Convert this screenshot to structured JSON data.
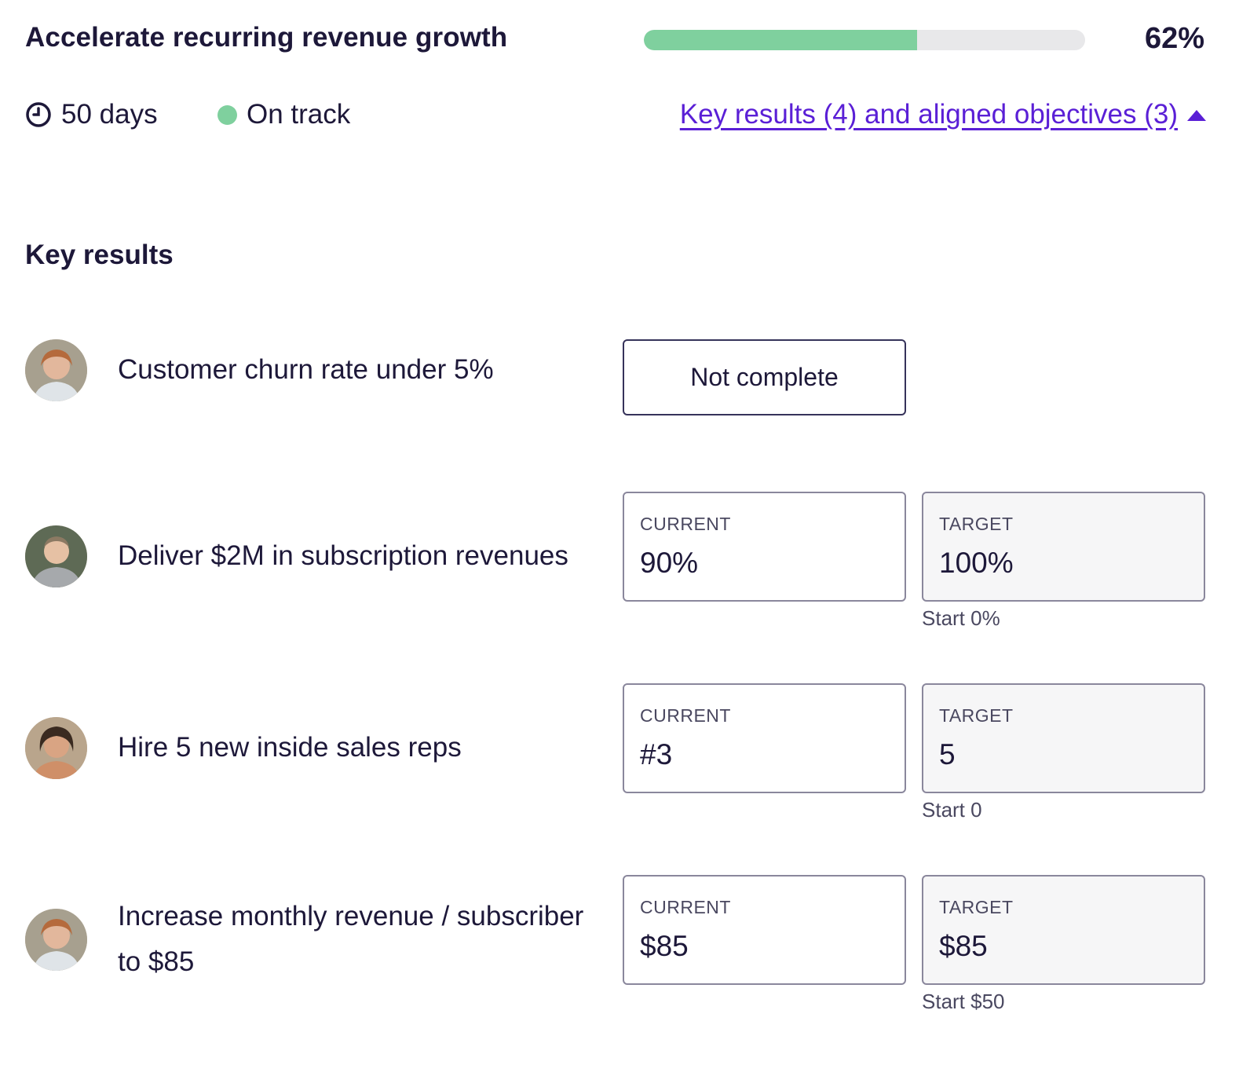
{
  "objective": {
    "title": "Accelerate recurring revenue growth",
    "progress_percent": 62,
    "progress_label": "62%",
    "days_label": "50 days",
    "status_label": "On track",
    "key_results_link": "Key results (4) and aligned objectives (3)"
  },
  "colors": {
    "progress_fill": "#7fd09e",
    "on_track": "#7fd09e",
    "link": "#5a1fd6"
  },
  "section_title": "Key results",
  "key_results": [
    {
      "title": "Customer churn rate under 5%",
      "button_label": "Not complete"
    },
    {
      "title": "Deliver $2M in subscription revenues",
      "current_label": "CURRENT",
      "current_value": "90%",
      "target_label": "TARGET",
      "target_value": "100%",
      "start": "Start 0%"
    },
    {
      "title": "Hire 5 new inside sales reps",
      "current_label": "CURRENT",
      "current_value": "#3",
      "target_label": "TARGET",
      "target_value": "5",
      "start": "Start 0"
    },
    {
      "title": "Increase monthly revenue / subscriber to $85",
      "current_label": "CURRENT",
      "current_value": "$85",
      "target_label": "TARGET",
      "target_value": "$85",
      "start": "Start $50"
    }
  ]
}
